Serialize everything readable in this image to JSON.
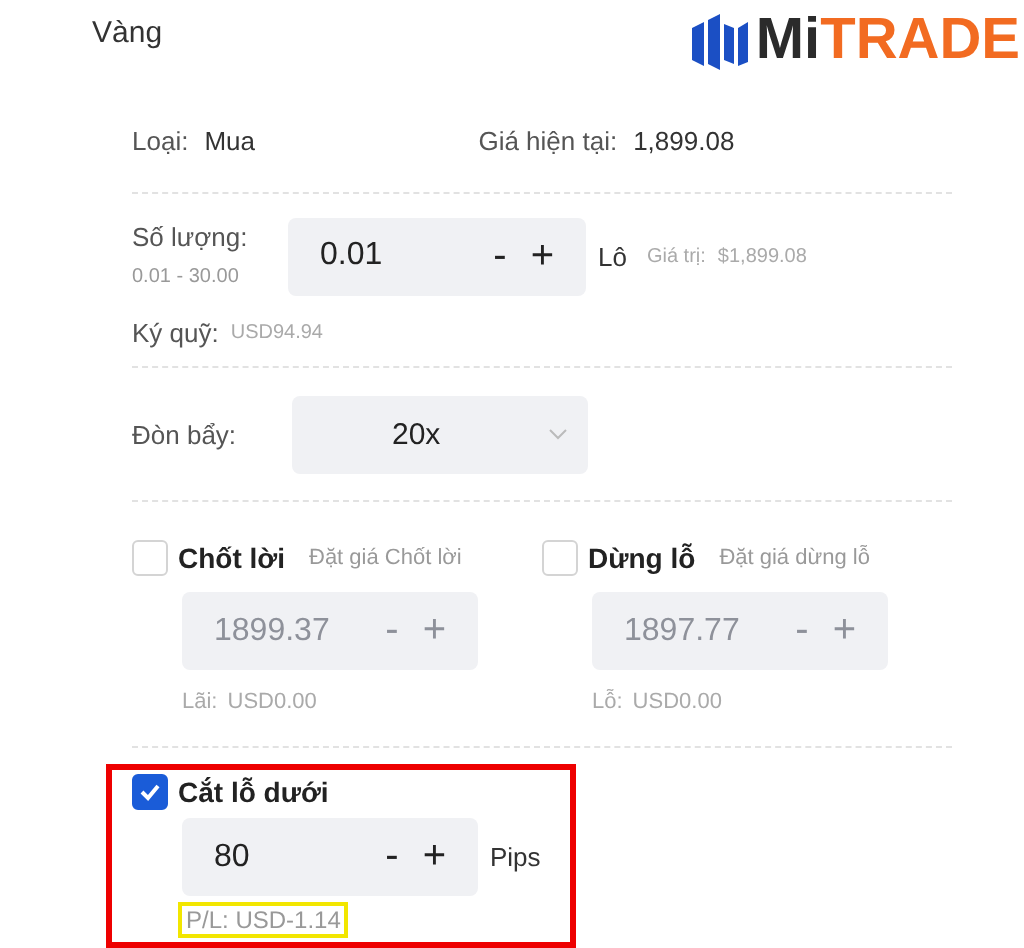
{
  "title": "Vàng",
  "logo": {
    "part_1": "Mi",
    "part_2": "TRADE"
  },
  "type": {
    "label": "Loại:",
    "value": "Mua"
  },
  "current_price": {
    "label": "Giá hiện tại:",
    "value": "1,899.08"
  },
  "quantity": {
    "label": "Số lượng:",
    "range": "0.01 - 30.00",
    "value": "0.01",
    "minus": "-",
    "plus": "+",
    "unit": "Lô",
    "worth_label": "Giá trị:",
    "worth": "$1,899.08"
  },
  "margin": {
    "label": "Ký quỹ:",
    "value": "USD94.94"
  },
  "leverage": {
    "label": "Đòn bẩy:",
    "value": "20x"
  },
  "orders": [
    {
      "label": "Chốt lời",
      "hint": "Đặt giá Chốt lời",
      "checked": false,
      "value": "1899.37",
      "minus": "-",
      "plus": "+",
      "result_label": "Lãi:",
      "result": "USD0.00"
    },
    {
      "label": "Dừng lỗ",
      "hint": "Đặt giá dừng lỗ",
      "checked": false,
      "value": "1897.77",
      "minus": "-",
      "plus": "+",
      "result_label": "Lỗ:",
      "result": "USD0.00"
    }
  ],
  "trailing_stop": {
    "label": "Cắt lỗ dưới",
    "checked": true,
    "highlighted": true,
    "value": "80",
    "minus": "-",
    "plus": "+",
    "unit": "Pips",
    "pl_label": "P/L:",
    "pl": "USD-1.14",
    "pl_highlighted": true
  }
}
